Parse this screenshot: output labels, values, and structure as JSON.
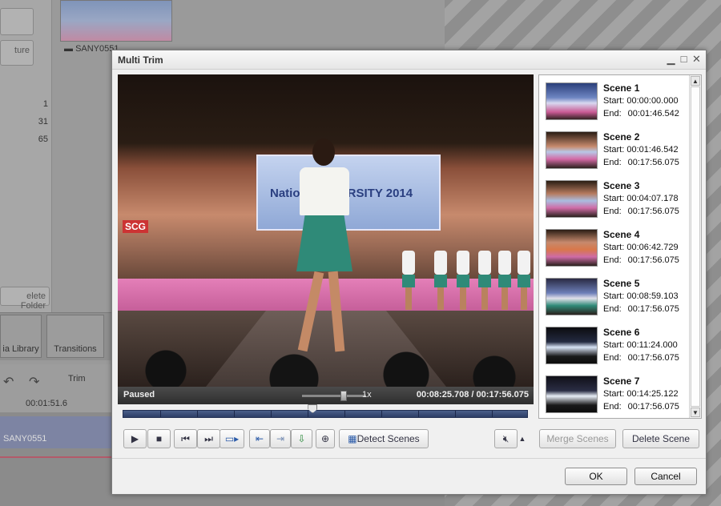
{
  "background": {
    "thumb_caption": "SANY0551",
    "side_label": "ture",
    "counts": [
      "1",
      "31",
      "65"
    ],
    "delete_folder": "elete Folder",
    "tabs": {
      "media_library": "ia Library",
      "transitions": "Transitions"
    },
    "toolbar": {
      "trim": "Trim",
      "time": "00:01:51.6"
    },
    "track_label": "SANY0551"
  },
  "dialog": {
    "title": "Multi Trim",
    "status": "Paused",
    "speed": "1x",
    "current_time": "00:08:25.708",
    "time_separator": "/",
    "total_time": "00:17:56.075",
    "playback_position": 0.469,
    "video_texts": {
      "banner": "Nation UNIVERSITY 2014",
      "sponsor": "SCG"
    },
    "buttons": {
      "detect_scenes": "Detect Scenes",
      "merge_scenes": "Merge Scenes",
      "delete_scene": "Delete Scene",
      "ok": "OK",
      "cancel": "Cancel"
    },
    "scenes": [
      {
        "name": "Scene 1",
        "start_label": "Start:",
        "start": "00:00:00.000",
        "end_label": "End:",
        "end": "00:01:46.542"
      },
      {
        "name": "Scene 2",
        "start_label": "Start:",
        "start": "00:01:46.542",
        "end_label": "End:",
        "end": "00:17:56.075"
      },
      {
        "name": "Scene 3",
        "start_label": "Start:",
        "start": "00:04:07.178",
        "end_label": "End:",
        "end": "00:17:56.075"
      },
      {
        "name": "Scene 4",
        "start_label": "Start:",
        "start": "00:06:42.729",
        "end_label": "End:",
        "end": "00:17:56.075"
      },
      {
        "name": "Scene 5",
        "start_label": "Start:",
        "start": "00:08:59.103",
        "end_label": "End:",
        "end": "00:17:56.075"
      },
      {
        "name": "Scene 6",
        "start_label": "Start:",
        "start": "00:11:24.000",
        "end_label": "End:",
        "end": "00:17:56.075"
      },
      {
        "name": "Scene 7",
        "start_label": "Start:",
        "start": "00:14:25.122",
        "end_label": "End:",
        "end": "00:17:56.075"
      }
    ]
  }
}
